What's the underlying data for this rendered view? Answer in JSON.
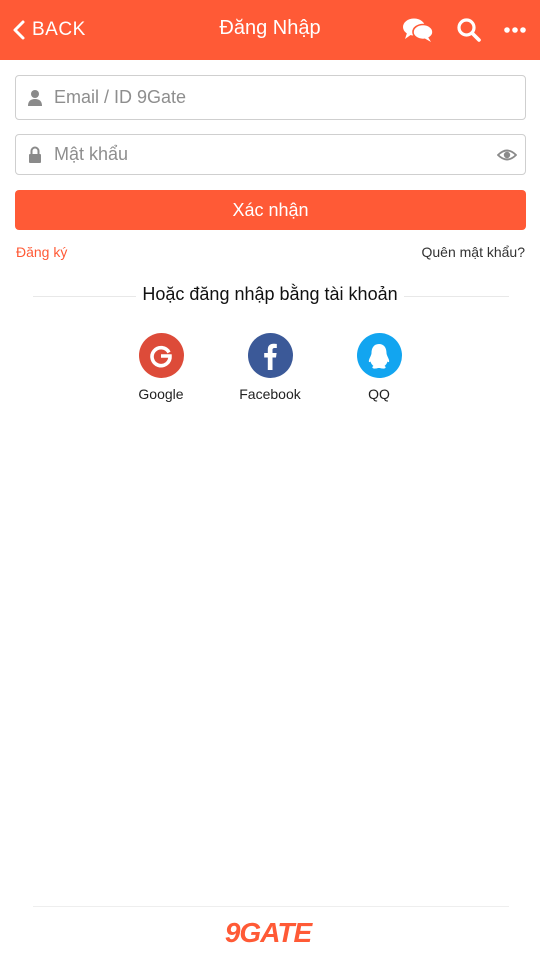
{
  "header": {
    "back_label": "BACK",
    "title": "Đăng Nhập",
    "icons": [
      "chevron-left-icon",
      "chat-icon",
      "search-icon",
      "more-icon"
    ]
  },
  "form": {
    "email_placeholder": "Email / ID 9Gate",
    "email_value": "",
    "password_placeholder": "Mật khẩu",
    "password_value": "",
    "submit_label": "Xác nhận"
  },
  "links": {
    "register": "Đăng ký",
    "forgot_password": "Quên mật khẩu?"
  },
  "social": {
    "heading": "Hoặc đăng nhập bằng tài khoản",
    "providers": [
      {
        "label": "Google",
        "icon": "google-icon",
        "color": "#dd4b39"
      },
      {
        "label": "Facebook",
        "icon": "facebook-icon",
        "color": "#3b5998"
      },
      {
        "label": "QQ",
        "icon": "qq-icon",
        "color": "#12a5f0"
      }
    ]
  },
  "footer": {
    "logo": "9GATE"
  },
  "colors": {
    "accent": "#ff5a36"
  }
}
